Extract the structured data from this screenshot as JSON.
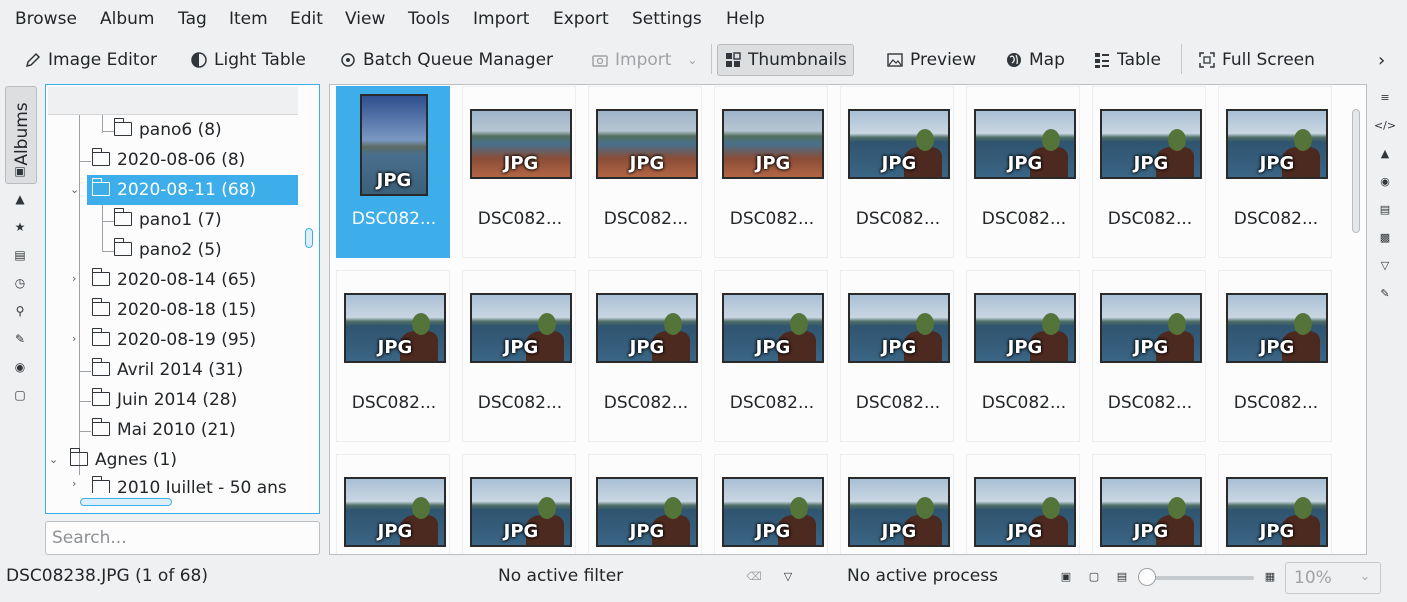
{
  "menu": [
    "Browse",
    "Album",
    "Tag",
    "Item",
    "Edit",
    "View",
    "Tools",
    "Import",
    "Export",
    "Settings",
    "Help"
  ],
  "toolbar": {
    "image_editor": "Image Editor",
    "light_table": "Light Table",
    "batch_queue": "Batch Queue Manager",
    "import": "Import",
    "thumbnails": "Thumbnails",
    "preview": "Preview",
    "map": "Map",
    "table": "Table",
    "full_screen": "Full Screen"
  },
  "left_tabs": {
    "albums": "Albums"
  },
  "album_tree": [
    {
      "label": "pano6 (8)"
    },
    {
      "label": "2020-08-06 (8)"
    },
    {
      "label": "2020-08-11 (68)",
      "selected": true
    },
    {
      "label": "pano1 (7)"
    },
    {
      "label": "pano2 (5)"
    },
    {
      "label": "2020-08-14 (65)"
    },
    {
      "label": "2020-08-18 (15)"
    },
    {
      "label": "2020-08-19 (95)"
    },
    {
      "label": "Avril 2014 (31)"
    },
    {
      "label": "Juin 2014 (28)"
    },
    {
      "label": "Mai 2010 (21)"
    },
    {
      "label": "Agnes (1)"
    },
    {
      "label": "2010 Juillet - 50 ans"
    }
  ],
  "search": {
    "placeholder": "Search..."
  },
  "thumbnails": {
    "badge": "JPG",
    "items": [
      {
        "label": "DSC082...",
        "selected": true,
        "orientation": "portrait"
      },
      {
        "label": "DSC082...",
        "orientation": "landscape"
      },
      {
        "label": "DSC082...",
        "orientation": "landscape"
      },
      {
        "label": "DSC082...",
        "orientation": "landscape"
      },
      {
        "label": "DSC082...",
        "orientation": "landscape"
      },
      {
        "label": "DSC082...",
        "orientation": "landscape"
      },
      {
        "label": "DSC082...",
        "orientation": "landscape"
      },
      {
        "label": "DSC082...",
        "orientation": "landscape"
      },
      {
        "label": "DSC082...",
        "orientation": "landscape"
      },
      {
        "label": "DSC082...",
        "orientation": "landscape"
      },
      {
        "label": "DSC082...",
        "orientation": "landscape"
      },
      {
        "label": "DSC082...",
        "orientation": "landscape"
      },
      {
        "label": "DSC082...",
        "orientation": "landscape"
      },
      {
        "label": "DSC082...",
        "orientation": "landscape"
      },
      {
        "label": "DSC082...",
        "orientation": "landscape"
      },
      {
        "label": "DSC082...",
        "orientation": "landscape"
      },
      {
        "label": "",
        "orientation": "landscape"
      },
      {
        "label": "",
        "orientation": "landscape"
      },
      {
        "label": "",
        "orientation": "landscape"
      },
      {
        "label": "",
        "orientation": "landscape"
      },
      {
        "label": "",
        "orientation": "landscape"
      },
      {
        "label": "",
        "orientation": "landscape"
      },
      {
        "label": "",
        "orientation": "landscape"
      },
      {
        "label": "",
        "orientation": "landscape"
      }
    ]
  },
  "status": {
    "file": "DSC08238.JPG (1 of 68)",
    "filter": "No active filter",
    "process": "No active process",
    "zoom": "10%"
  },
  "colors": {
    "accent": "#3daee9",
    "background": "#eff0f1"
  }
}
